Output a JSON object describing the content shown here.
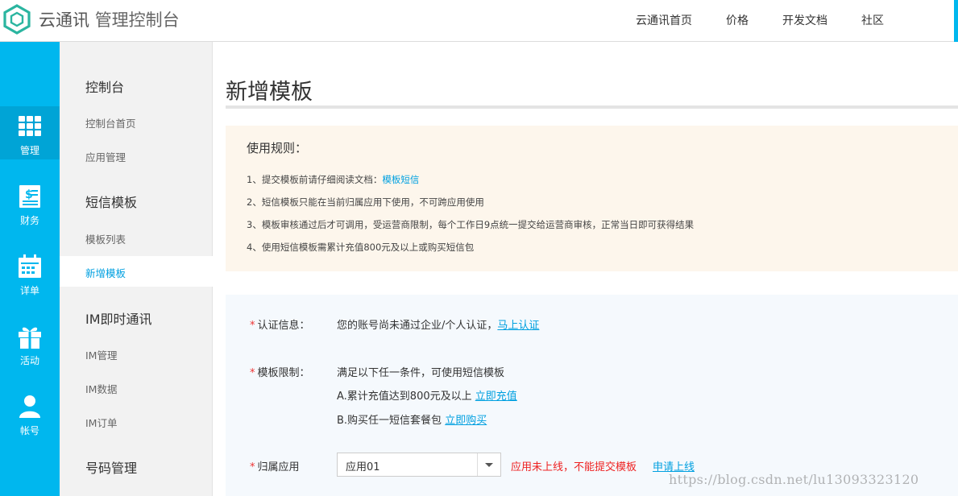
{
  "header": {
    "brand_name": "云通讯",
    "brand_sub": "管理控制台",
    "nav": [
      "云通讯首页",
      "价格",
      "开发文档",
      "社区"
    ],
    "accent_color": "#00b7ee"
  },
  "rail": {
    "items": [
      {
        "label": "管理",
        "icon": "grid-icon",
        "active": true
      },
      {
        "label": "财务",
        "icon": "finance-icon",
        "active": false
      },
      {
        "label": "详单",
        "icon": "calendar-icon",
        "active": false
      },
      {
        "label": "活动",
        "icon": "gift-icon",
        "active": false
      },
      {
        "label": "帐号",
        "icon": "user-icon",
        "active": false
      }
    ]
  },
  "menu": {
    "sections": [
      {
        "title": "控制台",
        "items": [
          "控制台首页",
          "应用管理"
        ]
      },
      {
        "title": "短信模板",
        "items": [
          "模板列表",
          "新增模板"
        ]
      },
      {
        "title": "IM即时通讯",
        "items": [
          "IM管理",
          "IM数据",
          "IM订单"
        ]
      },
      {
        "title": "号码管理",
        "items": []
      }
    ],
    "active_item": "新增模板"
  },
  "page": {
    "title": "新增模板"
  },
  "rules": {
    "heading": "使用规则：",
    "line1_prefix": "1、提交模板前请仔细阅读文档：",
    "line1_link": "模板短信",
    "line2": "2、短信模板只能在当前归属应用下使用，不可跨应用使用",
    "line3": "3、模板审核通过后才可调用，受运营商限制，每个工作日9点统一提交给运营商审核，正常当日即可获得结果",
    "line4": "4、使用短信模板需累计充值800元及以上或购买短信包"
  },
  "form": {
    "auth_label": "认证信息：",
    "auth_text": "您的账号尚未通过企业/个人认证，",
    "auth_link": "马上认证",
    "limit_label": "模板限制：",
    "limit_text": "满足以下任一条件，可使用短信模板",
    "option_a": "A.累计充值达到800元及以上",
    "option_a_link": "立即充值",
    "option_b": "B.购买任一短信套餐包",
    "option_b_link": "立即购买",
    "app_label": "归属应用",
    "app_value": "应用01",
    "app_warning": "应用未上线，不能提交模板",
    "apply_link": "申请上线",
    "required_mark": "*"
  },
  "watermark": "https://blog.csdn.net/lu13093323120"
}
